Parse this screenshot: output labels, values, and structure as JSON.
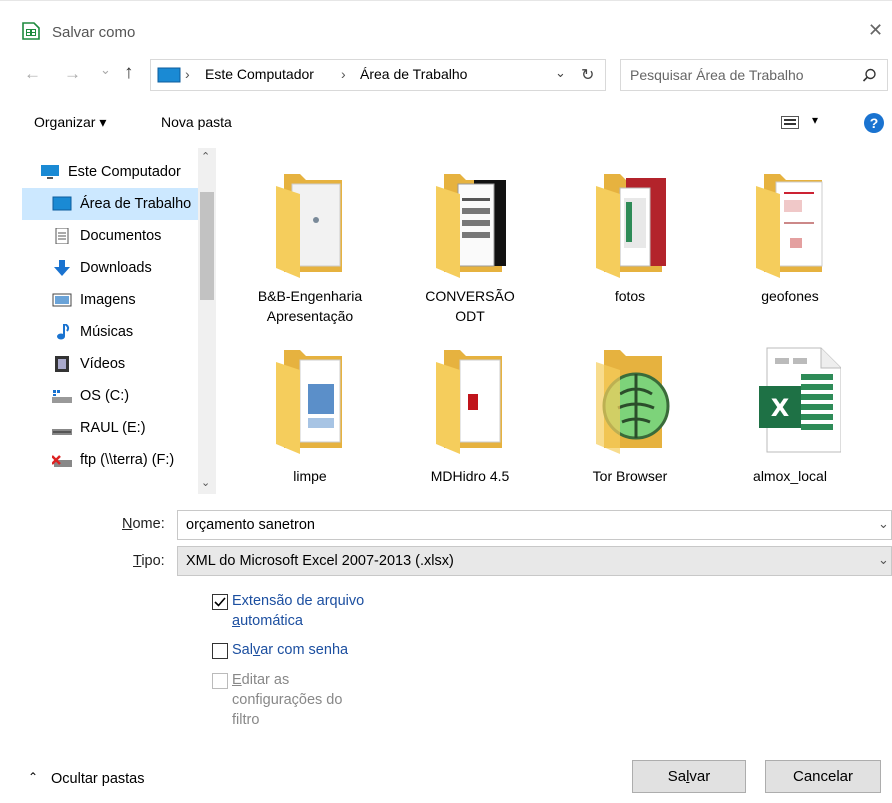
{
  "window": {
    "title": "Salvar como",
    "close_glyph": "✕"
  },
  "nav": {
    "back_glyph": "←",
    "forward_glyph": "→",
    "recent_glyph": "⌄",
    "up_glyph": "↑",
    "breadcrumb": [
      "Este Computador",
      "Área de Trabalho"
    ],
    "refresh_glyph": "↻",
    "search_placeholder": "Pesquisar Área de Trabalho"
  },
  "toolbar": {
    "organize_label": "Organizar ▾",
    "new_folder_label": "Nova pasta",
    "help_glyph": "?"
  },
  "sidebar": {
    "items": [
      {
        "label": "Este Computador",
        "icon": "computer-icon"
      },
      {
        "label": "Área de Trabalho",
        "icon": "desktop-icon",
        "selected": true
      },
      {
        "label": "Documentos",
        "icon": "documents-icon"
      },
      {
        "label": "Downloads",
        "icon": "downloads-icon"
      },
      {
        "label": "Imagens",
        "icon": "pictures-icon"
      },
      {
        "label": "Músicas",
        "icon": "music-icon"
      },
      {
        "label": "Vídeos",
        "icon": "videos-icon"
      },
      {
        "label": "OS (C:)",
        "icon": "drive-icon"
      },
      {
        "label": "RAUL (E:)",
        "icon": "usb-drive-icon"
      },
      {
        "label": "ftp (\\\\terra) (F:)",
        "icon": "network-drive-icon"
      }
    ]
  },
  "files": [
    {
      "line1": "B&B-Engenharia",
      "line2": "Apresentação",
      "icon": "folder-icon"
    },
    {
      "line1": "CONVERSÃO",
      "line2": "ODT",
      "icon": "folder-icon"
    },
    {
      "line1": "fotos",
      "line2": "",
      "icon": "folder-icon"
    },
    {
      "line1": "geofones",
      "line2": "",
      "icon": "folder-icon"
    },
    {
      "line1": "limpe",
      "line2": "",
      "icon": "folder-icon"
    },
    {
      "line1": "MDHidro 4.5",
      "line2": "",
      "icon": "folder-icon"
    },
    {
      "line1": "Tor Browser",
      "line2": "",
      "icon": "tor-browser-icon"
    },
    {
      "line1": "almox_local",
      "line2": "",
      "icon": "excel-file-icon"
    }
  ],
  "form": {
    "name_label_u": "N",
    "name_label_rest": "ome:",
    "name_value": "orçamento sanetron",
    "type_label_u": "T",
    "type_label_rest": "ipo:",
    "type_value": "XML do Microsoft Excel 2007-2013 (.xlsx)",
    "auto_ext_line1": "Extensão de arquivo",
    "auto_ext_line2_u": "a",
    "auto_ext_line2_rest": "utomática",
    "auto_ext_checked": true,
    "password_pre": "Sal",
    "password_u": "v",
    "password_rest": "ar com senha",
    "password_checked": false,
    "filter_u": "E",
    "filter_rest1": "ditar as",
    "filter_line2": "configurações do",
    "filter_line3": "filtro",
    "filter_enabled": false
  },
  "footer": {
    "hide_folders_label": "Ocultar pastas",
    "save_pre": "Sa",
    "save_u": "l",
    "save_rest": "var",
    "cancel_label": "Cancelar"
  },
  "colors": {
    "selection": "#cce8ff",
    "link_blue": "#1c4fa0",
    "folder": "#f5cd5c",
    "excel_green": "#1e7145"
  }
}
